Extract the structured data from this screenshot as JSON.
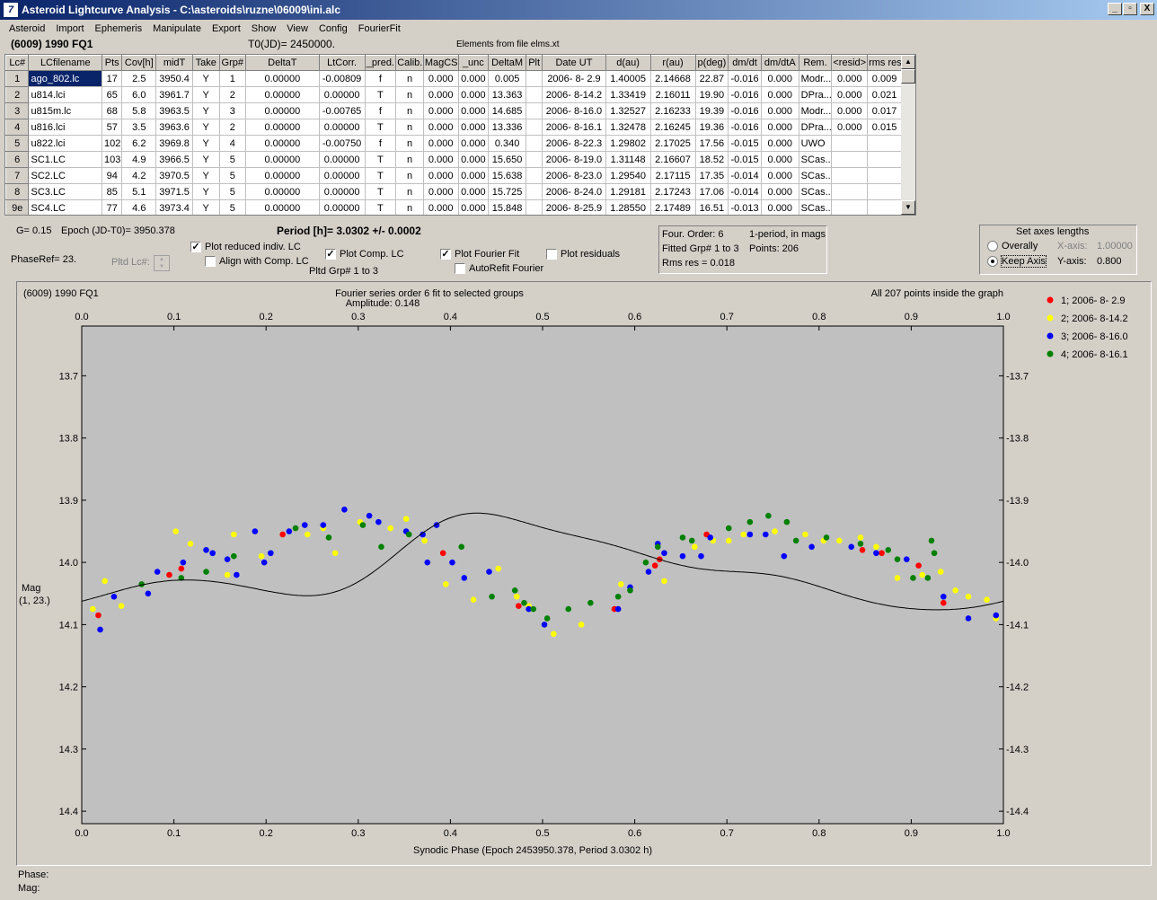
{
  "window": {
    "title": "Asteroid Lightcurve Analysis - C:\\asteroids\\ruzne\\06009\\ini.alc",
    "icon": "7",
    "buttons": [
      "_",
      "▫",
      "X"
    ]
  },
  "menu": [
    "Asteroid",
    "Import",
    "Ephemeris",
    "Manipulate",
    "Export",
    "Show",
    "View",
    "Config",
    "FourierFit"
  ],
  "header": {
    "asteroid": "(6009) 1990 FQ1",
    "t0": "T0(JD)= 2450000.",
    "elements": "Elements from file elms.xt"
  },
  "table": {
    "columns": [
      "Lc#",
      "LCfilename",
      "Pts",
      "Cov[h]",
      "midT",
      "Take",
      "Grp#",
      "DeltaT",
      "LtCorr.",
      "_pred.",
      "Calib.",
      "MagCS",
      "_unc",
      "DeltaM",
      "Plt",
      "Date UT",
      "d(au)",
      "r(au)",
      "p(deg)",
      "dm/dt",
      "dm/dtA",
      "Rem.",
      "<resid>",
      "rms res"
    ],
    "rows": [
      [
        "1",
        "ago_802.lc",
        "17",
        "2.5",
        "3950.4",
        "Y",
        "1",
        "0.00000",
        "-0.00809",
        "f",
        "n",
        "0.000",
        "0.000",
        "0.005",
        "",
        "2006- 8- 2.9",
        "1.40005",
        "2.14668",
        "22.87",
        "-0.016",
        "0.000",
        "Modr...",
        "0.000",
        "0.009"
      ],
      [
        "2",
        "u814.lci",
        "65",
        "6.0",
        "3961.7",
        "Y",
        "2",
        "0.00000",
        "0.00000",
        "T",
        "n",
        "0.000",
        "0.000",
        "13.363",
        "",
        "2006- 8-14.2",
        "1.33419",
        "2.16011",
        "19.90",
        "-0.016",
        "0.000",
        "DPra...",
        "0.000",
        "0.021"
      ],
      [
        "3",
        "u815m.lc",
        "68",
        "5.8",
        "3963.5",
        "Y",
        "3",
        "0.00000",
        "-0.00765",
        "f",
        "n",
        "0.000",
        "0.000",
        "14.685",
        "",
        "2006- 8-16.0",
        "1.32527",
        "2.16233",
        "19.39",
        "-0.016",
        "0.000",
        "Modr...",
        "0.000",
        "0.017"
      ],
      [
        "4",
        "u816.lci",
        "57",
        "3.5",
        "3963.6",
        "Y",
        "2",
        "0.00000",
        "0.00000",
        "T",
        "n",
        "0.000",
        "0.000",
        "13.336",
        "",
        "2006- 8-16.1",
        "1.32478",
        "2.16245",
        "19.36",
        "-0.016",
        "0.000",
        "DPra...",
        "0.000",
        "0.015"
      ],
      [
        "5",
        "u822.lci",
        "102",
        "6.2",
        "3969.8",
        "Y",
        "4",
        "0.00000",
        "-0.00750",
        "f",
        "n",
        "0.000",
        "0.000",
        "0.340",
        "",
        "2006- 8-22.3",
        "1.29802",
        "2.17025",
        "17.56",
        "-0.015",
        "0.000",
        "UWO",
        "",
        ""
      ],
      [
        "6",
        "SC1.LC",
        "103",
        "4.9",
        "3966.5",
        "Y",
        "5",
        "0.00000",
        "0.00000",
        "T",
        "n",
        "0.000",
        "0.000",
        "15.650",
        "",
        "2006- 8-19.0",
        "1.31148",
        "2.16607",
        "18.52",
        "-0.015",
        "0.000",
        "SCas...",
        "",
        ""
      ],
      [
        "7",
        "SC2.LC",
        "94",
        "4.2",
        "3970.5",
        "Y",
        "5",
        "0.00000",
        "0.00000",
        "T",
        "n",
        "0.000",
        "0.000",
        "15.638",
        "",
        "2006- 8-23.0",
        "1.29540",
        "2.17115",
        "17.35",
        "-0.014",
        "0.000",
        "SCas...",
        "",
        ""
      ],
      [
        "8",
        "SC3.LC",
        "85",
        "5.1",
        "3971.5",
        "Y",
        "5",
        "0.00000",
        "0.00000",
        "T",
        "n",
        "0.000",
        "0.000",
        "15.725",
        "",
        "2006- 8-24.0",
        "1.29181",
        "2.17243",
        "17.06",
        "-0.014",
        "0.000",
        "SCas...",
        "",
        ""
      ],
      [
        "9e",
        "SC4.LC",
        "77",
        "4.6",
        "3973.4",
        "Y",
        "5",
        "0.00000",
        "0.00000",
        "T",
        "n",
        "0.000",
        "0.000",
        "15.848",
        "",
        "2006- 8-25.9",
        "1.28550",
        "2.17489",
        "16.51",
        "-0.013",
        "0.000",
        "SCas...",
        "",
        ""
      ]
    ]
  },
  "controls": {
    "g": "G= 0.15",
    "epoch": "Epoch (JD-T0)= 3950.378",
    "period": "Period [h]= 3.0302 +/- 0.0002",
    "phaseref": "PhaseRef= 23.",
    "pltd_lc": "Pltd Lc#:",
    "plot_reduced": "Plot reduced indiv. LC",
    "align": "Align with Comp. LC",
    "plot_comp": "Plot Comp. LC",
    "pltd_grp": "Pltd Grp#  1   to   3",
    "plot_fourier": "Plot Fourier Fit",
    "autorefit": "AutoRefit Fourier",
    "plot_resid": "Plot residuals",
    "check_mark": "✓"
  },
  "fourier_box": {
    "order": "Four. Order:  6",
    "mode": "1-period, in mags",
    "fitted": "Fitted Grp# 1 to 3",
    "points": "Points: 206",
    "rms": "Rms res      = 0.018"
  },
  "axes_box": {
    "title": "Set axes lengths",
    "overall": "Overally",
    "keep": "Keep Axis",
    "xaxis_lbl": "X-axis:",
    "xaxis_val": "1.00000",
    "yaxis_lbl": "Y-axis:",
    "yaxis_val": "0.800"
  },
  "chart_data": {
    "type": "scatter",
    "title": "Fourier series order 6 fit to selected groups",
    "subtitle": "Amplitude: 0.148",
    "corner_left": "(6009) 1990 FQ1",
    "corner_right": "All 207 points inside the graph",
    "xlabel": "Synodic Phase (Epoch 2453950.378, Period 3.0302 h)",
    "ylabel": "Mag",
    "ylabel2": "(1, 23.)",
    "xlim": [
      0,
      1
    ],
    "ylim": [
      14.42,
      13.62
    ],
    "xticks": [
      "0.0",
      "0.1",
      "0.2",
      "0.3",
      "0.4",
      "0.5",
      "0.6",
      "0.7",
      "0.8",
      "0.9",
      "1.0"
    ],
    "yticks": [
      "13.7",
      "13.8",
      "13.9",
      "14.0",
      "14.1",
      "14.2",
      "14.3",
      "14.4"
    ],
    "fourier": {
      "mean": 14.015,
      "terms": [
        [
          0.0572,
          -0.0072
        ],
        [
          -0.0188,
          0.0005
        ],
        [
          0.0055,
          -0.0218
        ],
        [
          0.005,
          0.002
        ],
        [
          -0.0035,
          0.002
        ],
        [
          0.002,
          -0.001
        ]
      ]
    },
    "series": [
      {
        "name": "1; 2006- 8- 2.9",
        "color": "#ff0000",
        "points": [
          [
            0.018,
            14.085
          ],
          [
            0.095,
            14.02
          ],
          [
            0.108,
            14.01
          ],
          [
            0.218,
            13.955
          ],
          [
            0.392,
            13.985
          ],
          [
            0.474,
            14.07
          ],
          [
            0.578,
            14.075
          ],
          [
            0.622,
            14.005
          ],
          [
            0.627,
            13.995
          ],
          [
            0.678,
            13.955
          ],
          [
            0.847,
            13.98
          ],
          [
            0.868,
            13.985
          ],
          [
            0.908,
            14.005
          ],
          [
            0.935,
            14.065
          ]
        ]
      },
      {
        "name": "2; 2006- 8-14.2",
        "color": "#ffff00",
        "points": [
          [
            0.012,
            14.075
          ],
          [
            0.025,
            14.03
          ],
          [
            0.043,
            14.07
          ],
          [
            0.102,
            13.95
          ],
          [
            0.118,
            13.97
          ],
          [
            0.158,
            14.02
          ],
          [
            0.165,
            13.955
          ],
          [
            0.195,
            13.99
          ],
          [
            0.245,
            13.955
          ],
          [
            0.262,
            13.945
          ],
          [
            0.275,
            13.985
          ],
          [
            0.302,
            13.935
          ],
          [
            0.335,
            13.945
          ],
          [
            0.352,
            13.93
          ],
          [
            0.372,
            13.965
          ],
          [
            0.395,
            14.035
          ],
          [
            0.425,
            14.06
          ],
          [
            0.452,
            14.01
          ],
          [
            0.472,
            14.055
          ],
          [
            0.485,
            14.07
          ],
          [
            0.512,
            14.115
          ],
          [
            0.542,
            14.1
          ],
          [
            0.585,
            14.035
          ],
          [
            0.632,
            14.03
          ],
          [
            0.665,
            13.975
          ],
          [
            0.685,
            13.965
          ],
          [
            0.702,
            13.965
          ],
          [
            0.718,
            13.955
          ],
          [
            0.752,
            13.95
          ],
          [
            0.785,
            13.955
          ],
          [
            0.805,
            13.965
          ],
          [
            0.822,
            13.965
          ],
          [
            0.845,
            13.96
          ],
          [
            0.862,
            13.975
          ],
          [
            0.885,
            14.025
          ],
          [
            0.912,
            14.02
          ],
          [
            0.932,
            14.015
          ],
          [
            0.948,
            14.045
          ],
          [
            0.962,
            14.055
          ],
          [
            0.982,
            14.06
          ],
          [
            0.992,
            14.09
          ]
        ]
      },
      {
        "name": "3; 2006- 8-16.0",
        "color": "#0000ff",
        "points": [
          [
            0.02,
            14.108
          ],
          [
            0.035,
            14.055
          ],
          [
            0.072,
            14.05
          ],
          [
            0.082,
            14.015
          ],
          [
            0.11,
            14.0
          ],
          [
            0.135,
            13.98
          ],
          [
            0.142,
            13.985
          ],
          [
            0.158,
            13.995
          ],
          [
            0.168,
            14.02
          ],
          [
            0.188,
            13.95
          ],
          [
            0.198,
            14.0
          ],
          [
            0.205,
            13.985
          ],
          [
            0.225,
            13.95
          ],
          [
            0.242,
            13.94
          ],
          [
            0.262,
            13.94
          ],
          [
            0.285,
            13.915
          ],
          [
            0.312,
            13.925
          ],
          [
            0.322,
            13.935
          ],
          [
            0.352,
            13.95
          ],
          [
            0.37,
            13.955
          ],
          [
            0.375,
            14.0
          ],
          [
            0.385,
            13.94
          ],
          [
            0.402,
            14.0
          ],
          [
            0.415,
            14.025
          ],
          [
            0.442,
            14.015
          ],
          [
            0.485,
            14.075
          ],
          [
            0.502,
            14.1
          ],
          [
            0.582,
            14.075
          ],
          [
            0.595,
            14.04
          ],
          [
            0.615,
            14.015
          ],
          [
            0.625,
            13.97
          ],
          [
            0.632,
            13.985
          ],
          [
            0.652,
            13.99
          ],
          [
            0.672,
            13.99
          ],
          [
            0.682,
            13.96
          ],
          [
            0.725,
            13.955
          ],
          [
            0.742,
            13.955
          ],
          [
            0.762,
            13.99
          ],
          [
            0.792,
            13.975
          ],
          [
            0.835,
            13.975
          ],
          [
            0.862,
            13.985
          ],
          [
            0.895,
            13.995
          ],
          [
            0.935,
            14.055
          ],
          [
            0.962,
            14.09
          ],
          [
            0.992,
            14.085
          ]
        ]
      },
      {
        "name": "4; 2006- 8-16.1",
        "color": "#008000",
        "points": [
          [
            0.065,
            14.035
          ],
          [
            0.108,
            14.025
          ],
          [
            0.135,
            14.015
          ],
          [
            0.165,
            13.99
          ],
          [
            0.232,
            13.945
          ],
          [
            0.268,
            13.96
          ],
          [
            0.305,
            13.94
          ],
          [
            0.325,
            13.975
          ],
          [
            0.355,
            13.955
          ],
          [
            0.412,
            13.975
          ],
          [
            0.445,
            14.055
          ],
          [
            0.47,
            14.045
          ],
          [
            0.48,
            14.065
          ],
          [
            0.49,
            14.075
          ],
          [
            0.505,
            14.09
          ],
          [
            0.528,
            14.075
          ],
          [
            0.552,
            14.065
          ],
          [
            0.582,
            14.055
          ],
          [
            0.595,
            14.045
          ],
          [
            0.612,
            14.0
          ],
          [
            0.625,
            13.975
          ],
          [
            0.652,
            13.96
          ],
          [
            0.662,
            13.965
          ],
          [
            0.702,
            13.945
          ],
          [
            0.725,
            13.935
          ],
          [
            0.745,
            13.925
          ],
          [
            0.765,
            13.935
          ],
          [
            0.775,
            13.965
          ],
          [
            0.808,
            13.96
          ],
          [
            0.845,
            13.97
          ],
          [
            0.875,
            13.98
          ],
          [
            0.885,
            13.995
          ],
          [
            0.902,
            14.025
          ],
          [
            0.925,
            13.985
          ],
          [
            0.918,
            14.025
          ],
          [
            0.922,
            13.965
          ]
        ]
      }
    ]
  },
  "status": {
    "phase": "Phase:",
    "mag": "Mag:"
  }
}
